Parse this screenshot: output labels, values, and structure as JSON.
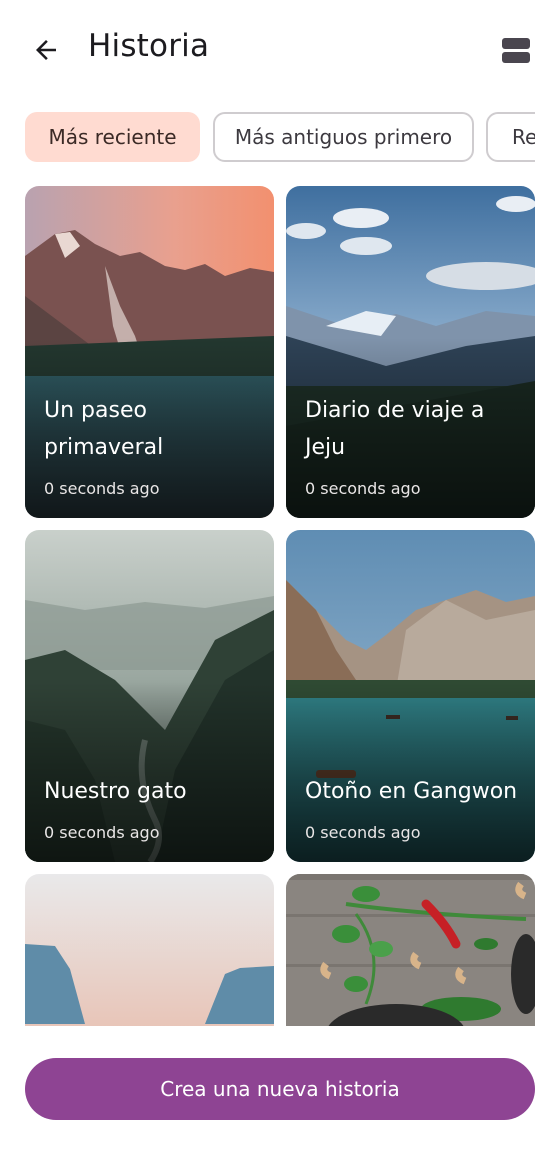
{
  "header": {
    "title": "Historia",
    "back_icon": "arrow-back-icon",
    "layout_icon": "view-agenda-icon"
  },
  "filters": {
    "chips": [
      {
        "label": "Más reciente",
        "selected": true
      },
      {
        "label": "Más antiguos primero",
        "selected": false
      },
      {
        "label": "Re",
        "selected": false
      }
    ]
  },
  "stories": [
    {
      "title": "Un paseo primaveral",
      "time": "0 seconds ago"
    },
    {
      "title": "Diario de viaje a Jeju",
      "time": "0 seconds ago"
    },
    {
      "title": "Nuestro gato",
      "time": "0 seconds ago"
    },
    {
      "title": "Otoño en Gangwon",
      "time": "0 seconds ago"
    }
  ],
  "cta": {
    "label": "Crea una nueva historia"
  },
  "colors": {
    "accent": "#8e4493",
    "chip_selected": "#ffdbd1"
  }
}
